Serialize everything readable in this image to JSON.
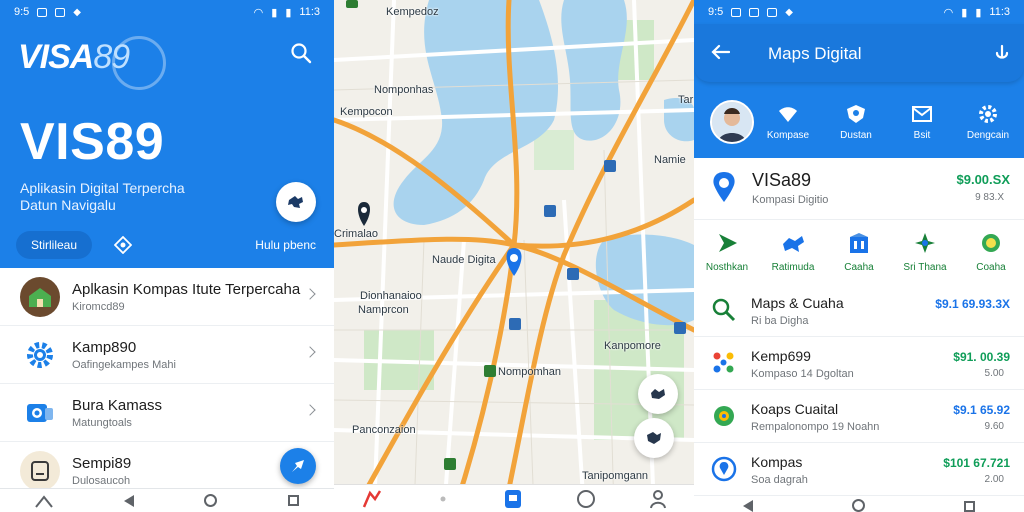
{
  "colors": {
    "primary_blue": "#1c80e8",
    "accent_green": "#0f9d58",
    "map_water": "#a9d3ee",
    "map_road": "#f2a33a"
  },
  "panel1": {
    "status": {
      "time_left": "9:5",
      "time_right": "11:3"
    },
    "logo": {
      "main": "VISA",
      "num": "89"
    },
    "title": "VIS89",
    "tagline": "Aplikasin Digital Terpercha Datun Navigalu",
    "pill": "Stirlileau",
    "head_link": "Hulu pbenc",
    "items": [
      {
        "title": "Aplkasin Kompas Itute Terpercaha",
        "subtitle": "Kiromcd89"
      },
      {
        "title": "Kamp890",
        "subtitle": "Oafingekampes Mahi"
      },
      {
        "title": "Bura Kamass",
        "subtitle": "Matungtoals"
      },
      {
        "title": "Sempi89",
        "subtitle": "Dulosaucoh"
      }
    ]
  },
  "panel2": {
    "labels": [
      {
        "text": "Kempedoz",
        "id": "l1"
      },
      {
        "text": "Kempocon",
        "id": "l2"
      },
      {
        "text": "Namie",
        "id": "l3"
      },
      {
        "text": "Crimalao",
        "id": "l4"
      },
      {
        "text": "Naude Digita",
        "id": "l5"
      },
      {
        "text": "Dionhanaioo",
        "id": "l6"
      },
      {
        "text": "Namprcon",
        "id": "l7"
      },
      {
        "text": "Nompomhan",
        "id": "l8"
      },
      {
        "text": "Kanpomore",
        "id": "l9"
      },
      {
        "text": "Panconzaion",
        "id": "l10"
      },
      {
        "text": "Tanipomgann",
        "id": "l11"
      },
      {
        "text": "Nomponhas",
        "id": "l12"
      },
      {
        "text": "Tar",
        "id": "l13"
      }
    ]
  },
  "panel3": {
    "status": {
      "time_left": "9:5",
      "time_right": "11:3"
    },
    "title": "Maps Digital",
    "quick_actions": [
      "Kompase",
      "Dustan",
      "Bsit",
      "Dengcain"
    ],
    "top": {
      "name": "VISa89",
      "subtitle": "Kompasi Digitio",
      "value": "$9.00.SX",
      "sub": "9 83.X"
    },
    "categories": [
      "Nosthkan",
      "Ratimuda",
      "Caaha",
      "Sri Thana",
      "Coaha"
    ],
    "rows": [
      {
        "title": "Maps & Cuaha",
        "subtitle": "Ri ba Digha",
        "value": "$9.1 69.93.3X",
        "sub": "",
        "value_color": "#1a73e8"
      },
      {
        "title": "Kemp699",
        "subtitle": "Kompaso 14 Dgoltan",
        "value": "$91. 00.39",
        "sub": "5.00",
        "value_color": "#0f9d58"
      },
      {
        "title": "Koaps Cuaital",
        "subtitle": "Rempalonompo 19 Noahn",
        "value": "$9.1 65.92",
        "sub": "9.60",
        "value_color": "#1a73e8"
      },
      {
        "title": "Kompas",
        "subtitle": "Soa dagrah",
        "value": "$101 67.721",
        "sub": "2.00",
        "value_color": "#0f9d58"
      }
    ]
  }
}
